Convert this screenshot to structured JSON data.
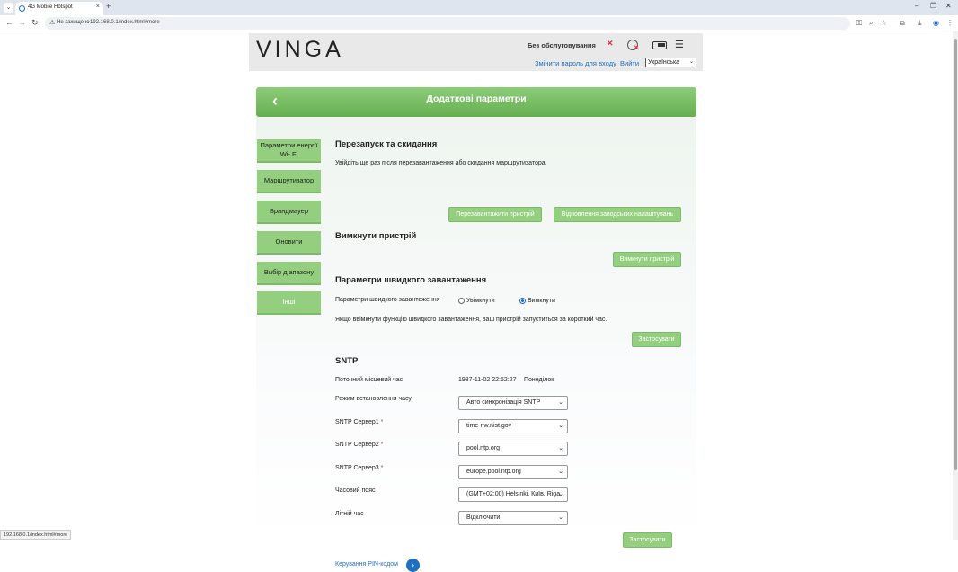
{
  "browser": {
    "tab_title": "4G Mobile Hotspot",
    "tab_close": "×",
    "new_tab": "+",
    "tab_menu": "⌄",
    "win_minimize": "–",
    "win_restore": "❐",
    "win_close": "✕",
    "security_warning": "Не захищено",
    "url": "192.168.0.1/index.html#more",
    "status_url": "192.168.0.1/index.html#more"
  },
  "header": {
    "logo": "VINGA",
    "no_service": "Без обслуговування",
    "change_password": "Змінити пароль для входу",
    "logout": "Вийти",
    "language": "Українська"
  },
  "banner": {
    "title": "Додаткові параметри"
  },
  "sidebar": {
    "items": [
      {
        "label": "Параметри енергії Wi- Fi"
      },
      {
        "label": "Маршрутизатор"
      },
      {
        "label": "Брандмауер"
      },
      {
        "label": "Оновити"
      },
      {
        "label": "Вибір діапазону"
      },
      {
        "label": "Інші"
      }
    ]
  },
  "reboot_section": {
    "title": "Перезапуск та скидання",
    "description": "Увійдіть ще раз після перезавантаження або скидання маршрутизатора",
    "reboot_button": "Перезавантажити пристрій",
    "factory_reset_button": "Відновлення заводських налаштувань"
  },
  "poweroff_section": {
    "title": "Вимкнути пристрій",
    "button": "Вимкнути пристрій"
  },
  "fastboot_section": {
    "title": "Параметри швидкого завантаження",
    "label": "Параметри швидкого завантаження",
    "option_on": "Увімкнути",
    "option_off": "Вимкнути",
    "selected": "Вимкнути",
    "note": "Якщо ввімкнути функцію швидкого завантаження, ваш пристрій запуститься за короткий час.",
    "apply_button": "Застосувати"
  },
  "sntp_section": {
    "title": "SNTP",
    "local_time_label": "Поточний місцевий час",
    "local_time_value": "1987-11-02 22:52:27",
    "local_day": "Понеділок",
    "mode_label": "Режим встановлення часу",
    "mode_value": "Авто синхронізація SNTP",
    "server1_label": "SNTP Сервер1",
    "server1_value": "time-nw.nist.gov",
    "server2_label": "SNTP Сервер2",
    "server2_value": "pool.ntp.org",
    "server3_label": "SNTP Сервер3",
    "server3_value": "europe.pool.ntp.org",
    "required_mark": "*",
    "timezone_label": "Часовий пояс",
    "timezone_value": "(GMT+02:00) Helsinki, Київ, Riga",
    "dst_label": "Літній час",
    "dst_value": "Відключити",
    "apply_button": "Застосувати"
  },
  "pin_link": {
    "label": "Керування PIN-кодом"
  },
  "colors": {
    "accent_green": "#93cf7e",
    "link_blue": "#1f6fc0"
  }
}
